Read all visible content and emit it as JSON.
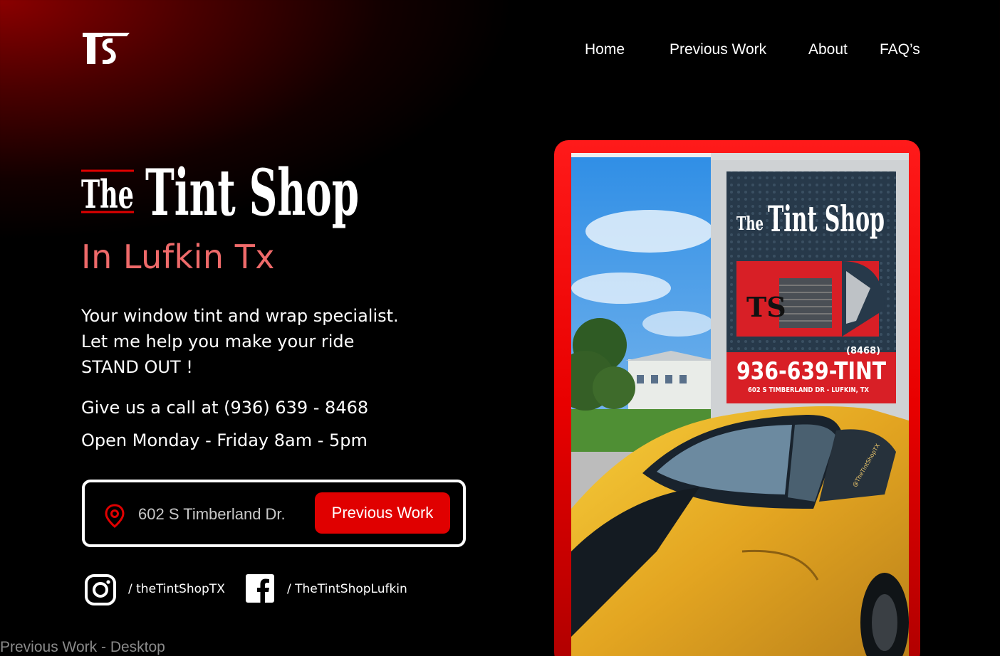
{
  "nav": {
    "logo": "TS",
    "items": [
      {
        "label": "Home"
      },
      {
        "label": "Previous Work"
      },
      {
        "label": "About"
      },
      {
        "label": "FAQ’s"
      }
    ]
  },
  "hero": {
    "brand_small": "The",
    "brand_large": "Tint Shop",
    "subtitle": "In Lufkin Tx",
    "tagline_lines": [
      "Your window tint and wrap specialist.",
      "Let me help you make your ride",
      "STAND OUT !"
    ],
    "call_text": "Give us a call at (936) 639 - 8468",
    "hours_text": "Open Monday - Friday 8am - 5pm"
  },
  "address_box": {
    "icon": "location-pin-icon",
    "address": "602 S Timberland Dr.",
    "button_label": "Previous Work"
  },
  "social": {
    "instagram": {
      "icon": "instagram-icon",
      "handle": "/ theTintShopTX"
    },
    "facebook": {
      "icon": "facebook-icon",
      "handle": "/ TheTintShopLufkin"
    }
  },
  "photo": {
    "sign_brand_small": "The",
    "sign_brand_large": "Tint Shop",
    "sign_logo": "TS",
    "sign_small_digits": "(8468)",
    "sign_phone": "936-639-TINT",
    "sign_address": "602 S TIMBERLAND DR - LUFKIN, TX",
    "car_decal": "@TheTintShopTX"
  },
  "frame_label": "Previous Work - Desktop",
  "colors": {
    "accent_red": "#e00000",
    "subtitle_pink": "#ef6a6a",
    "background": "#000000"
  }
}
